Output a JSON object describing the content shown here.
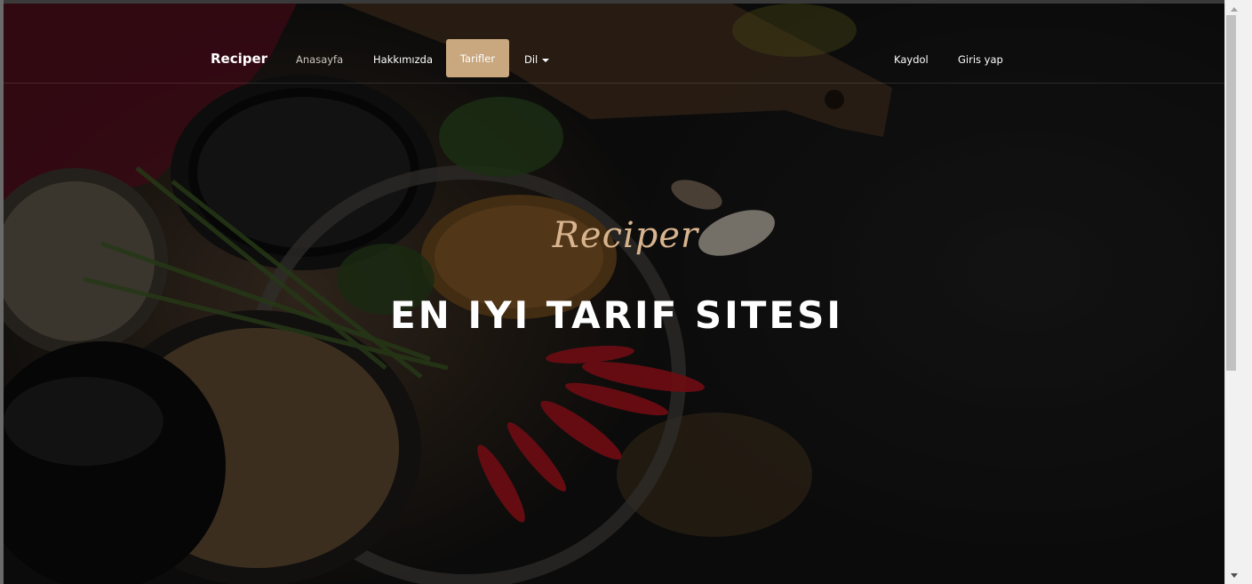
{
  "navbar": {
    "brand": "Reciper",
    "links": [
      {
        "label": "Anasayfa"
      },
      {
        "label": "Hakkımızda"
      },
      {
        "label": "Tarifler",
        "active": true
      },
      {
        "label": "Dil"
      }
    ],
    "auth": [
      {
        "label": "Kaydol"
      },
      {
        "label": "Giris yap"
      }
    ]
  },
  "hero": {
    "script_title": "Reciper",
    "headline": "EN IYI TARIF SITESI"
  },
  "colors": {
    "accent": "#c9a77f",
    "script_accent": "#d8b48e"
  }
}
